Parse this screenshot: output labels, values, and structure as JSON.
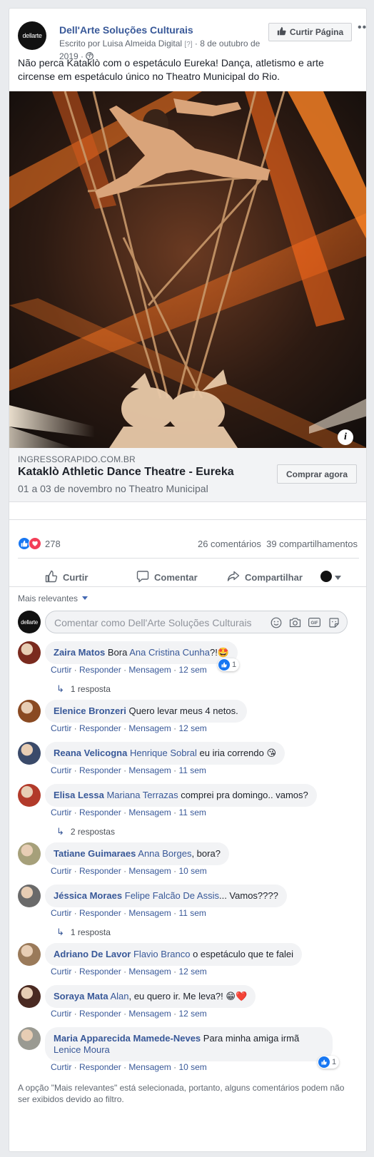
{
  "post": {
    "page_name": "Dell'Arte Soluções Culturais",
    "avatar_text": "dellarte",
    "author_line": "Escrito por Luisa Almeida Digital",
    "help_mark": "[?]",
    "date": "· 8 de outubro de 2019 ·",
    "like_page_label": "Curtir Página",
    "more_label": "•••",
    "text": "Não perca Kataklò com o espetáculo Eureka! Dança, atletismo e arte circense em espetáculo único no Theatro Municipal do Rio."
  },
  "link": {
    "domain": "INGRESSORAPIDO.COM.BR",
    "title": "Kataklò Athletic Dance Theatre - Eureka",
    "description": "01 a 03 de novembro no Theatro Municipal",
    "cta": "Comprar agora",
    "info_icon": "i"
  },
  "stats": {
    "reactions_count": "278",
    "comments": "26 comentários",
    "shares": "39 compartilhamentos"
  },
  "actions": {
    "like": "Curtir",
    "comment": "Comentar",
    "share": "Compartilhar"
  },
  "filter_label": "Mais relevantes",
  "composer_placeholder": "Comentar como Dell'Arte Soluções Culturais",
  "comment_actions": {
    "like": "Curtir",
    "reply": "Responder",
    "message": "Mensagem",
    "sep": " · "
  },
  "comments": [
    {
      "author": "Zaira Matos",
      "pre": "Bora",
      "tag": "Ana Cristina Cunha",
      "text": "?!",
      "emoji": "🤩",
      "time": "12 sem",
      "badge": "1",
      "replies": "1 resposta",
      "color": "#7a2a1e"
    },
    {
      "author": "Elenice Bronzeri",
      "pre": "",
      "tag": "",
      "text": "Quero levar meus 4 netos.",
      "emoji": "",
      "time": "12 sem",
      "badge": "",
      "replies": "",
      "color": "#8a4a22"
    },
    {
      "author": "Reana Velicogna",
      "pre": "",
      "tag": "Henrique Sobral",
      "text": "eu iria correndo",
      "emoji": "😘",
      "time": "11 sem",
      "badge": "",
      "replies": "",
      "color": "#3a4a6a"
    },
    {
      "author": "Elisa Lessa",
      "pre": "",
      "tag": "Mariana Terrazas",
      "text": "comprei pra domingo.. vamos?",
      "emoji": "",
      "time": "11 sem",
      "badge": "",
      "replies": "2 respostas",
      "color": "#b23a2a"
    },
    {
      "author": "Tatiane Guimaraes",
      "pre": "",
      "tag": "Anna Borges",
      "text": ", bora?",
      "emoji": "",
      "time": "10 sem",
      "badge": "",
      "replies": "",
      "color": "#a6a07a"
    },
    {
      "author": "Jéssica Moraes",
      "pre": "",
      "tag": "Felipe Falcão De Assis",
      "text": "... Vamos????",
      "emoji": "",
      "time": "11 sem",
      "badge": "",
      "replies": "1 resposta",
      "color": "#6a6a6a"
    },
    {
      "author": "Adriano De Lavor",
      "pre": "",
      "tag": "Flavio Branco",
      "text": "o espetáculo que te falei",
      "emoji": "",
      "time": "12 sem",
      "badge": "",
      "replies": "",
      "color": "#9a7a5a"
    },
    {
      "author": "Soraya Mata",
      "pre": "",
      "tag": "Alan",
      "text": ", eu quero ir. Me leva?!",
      "emoji": "😁❤️",
      "time": "12 sem",
      "badge": "",
      "replies": "",
      "color": "#4a2a22"
    },
    {
      "author": "Maria Apparecida Mamede-Neves",
      "pre": "",
      "tag": "",
      "text": "Para minha amiga irmã",
      "tag2": "Lenice Moura",
      "emoji": "",
      "time": "10 sem",
      "badge": "1",
      "replies": "",
      "color": "#9a9a92"
    }
  ],
  "footer_note": "A opção \"Mais relevantes\" está selecionada, portanto, alguns comentários podem não ser exibidos devido ao filtro."
}
